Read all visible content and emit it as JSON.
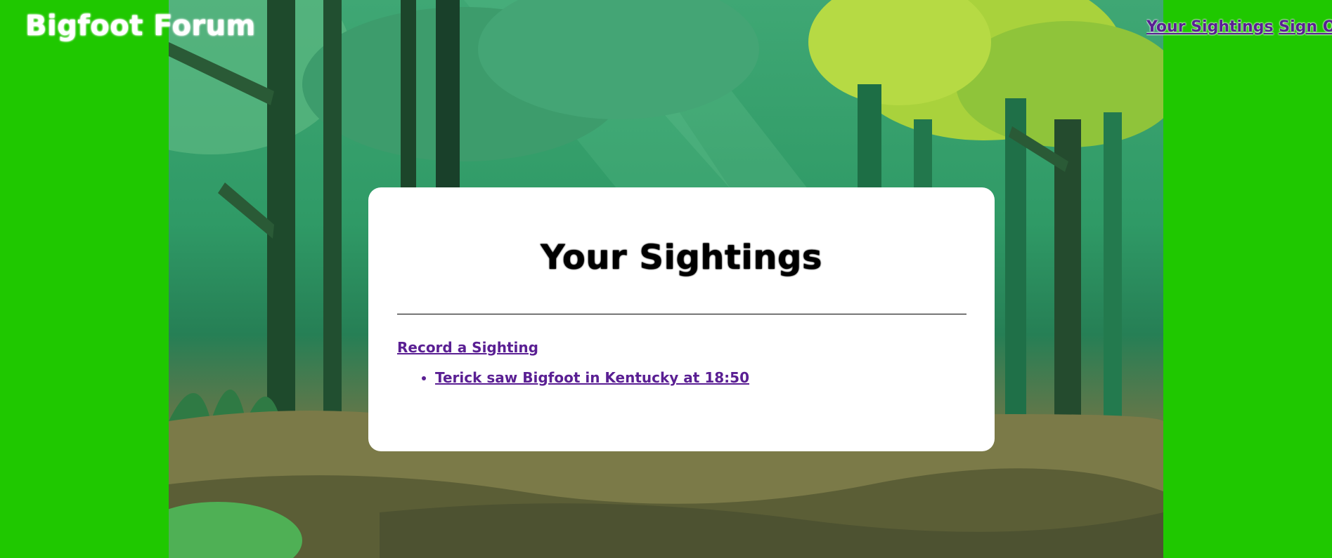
{
  "header": {
    "title": "Bigfoot Forum",
    "nav": {
      "sightings_label": "Your Sightings",
      "signout_label": "Sign Out"
    }
  },
  "main": {
    "heading": "Your Sightings",
    "record_label": "Record a Sighting",
    "sightings": [
      "Terick saw Bigfoot in Kentucky at 18:50"
    ]
  },
  "colors": {
    "background": "#1fc800",
    "link": "#5a1f93",
    "card": "#ffffff"
  }
}
